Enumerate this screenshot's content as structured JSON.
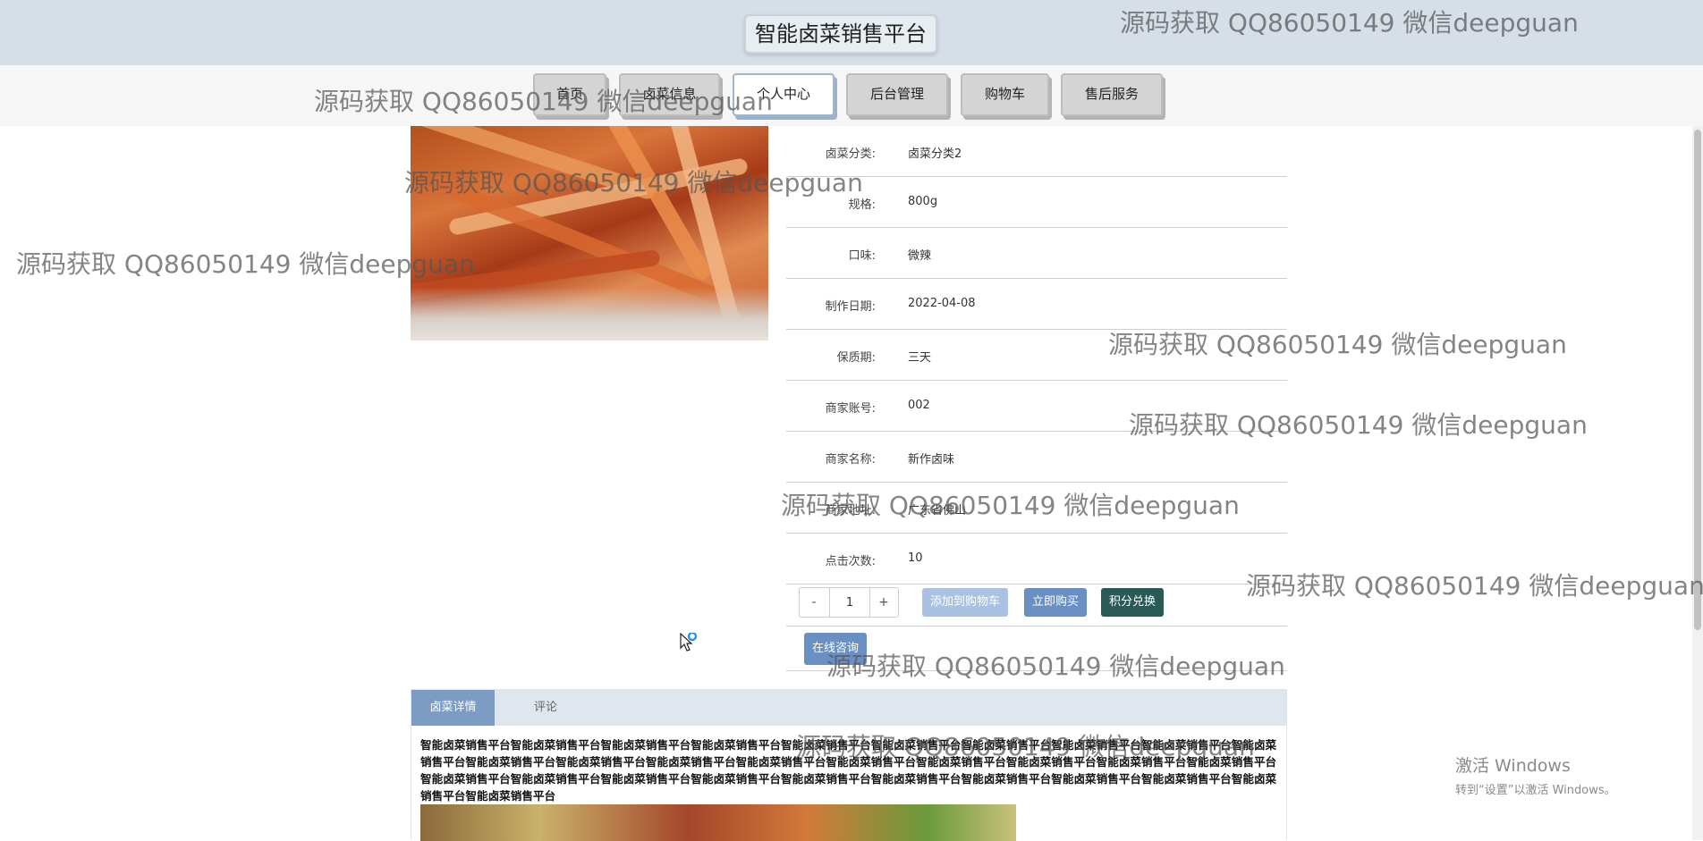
{
  "header": {
    "title": "智能卤菜销售平台"
  },
  "nav": {
    "items": [
      {
        "label": "首页"
      },
      {
        "label": "卤菜信息"
      },
      {
        "label": "个人中心"
      },
      {
        "label": "后台管理"
      },
      {
        "label": "购物车"
      },
      {
        "label": "售后服务"
      }
    ],
    "active_index": 2
  },
  "product": {
    "fields": [
      {
        "label": "卤菜分类:",
        "value": "卤菜分类2"
      },
      {
        "label": "规格:",
        "value": "800g"
      },
      {
        "label": "口味:",
        "value": "微辣"
      },
      {
        "label": "制作日期:",
        "value": "2022-04-08"
      },
      {
        "label": "保质期:",
        "value": "三天"
      },
      {
        "label": "商家账号:",
        "value": "002"
      },
      {
        "label": "商家名称:",
        "value": "新作卤味"
      },
      {
        "label": "商家地址:",
        "value": "广东省佛山"
      },
      {
        "label": "点击次数:",
        "value": "10"
      }
    ],
    "quantity": {
      "minus": "-",
      "value": "1",
      "plus": "+"
    },
    "buttons": {
      "add_cart": "添加到购物车",
      "buy_now": "立即购买",
      "points_exchange": "积分兑换",
      "consult": "在线咨询"
    }
  },
  "tabs": {
    "items": [
      {
        "label": "卤菜详情"
      },
      {
        "label": "评论"
      }
    ],
    "active_index": 0
  },
  "description": "智能卤菜销售平台智能卤菜销售平台智能卤菜销售平台智能卤菜销售平台智能卤菜销售平台智能卤菜销售平台智能卤菜销售平台智能卤菜销售平台智能卤菜销售平台智能卤菜销售平台智能卤菜销售平台智能卤菜销售平台智能卤菜销售平台智能卤菜销售平台智能卤菜销售平台智能卤菜销售平台智能卤菜销售平台智能卤菜销售平台智能卤菜销售平台智能卤菜销售平台智能卤菜销售平台智能卤菜销售平台智能卤菜销售平台智能卤菜销售平台智能卤菜销售平台智能卤菜销售平台智能卤菜销售平台智能卤菜销售平台智能卤菜销售平台智能卤菜销售平台",
  "watermark": "源码获取 QQ86050149 微信deepguan",
  "os_overlay": {
    "line1": "激活 Windows",
    "line2": "转到“设置”以激活 Windows。"
  },
  "colors": {
    "topbar": "#d6dfe8",
    "primary_button": "#6a8fc2",
    "disabled_button": "#a9c2e2",
    "dark_button": "#2a5a55",
    "active_tab": "#7d9cc4"
  }
}
